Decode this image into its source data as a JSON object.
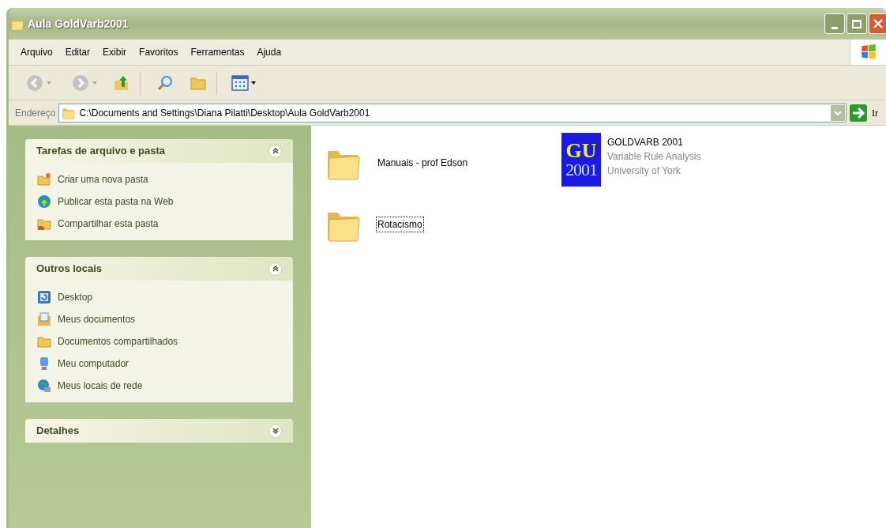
{
  "window": {
    "title": "Aula GoldVarb2001"
  },
  "menu": [
    "Arquivo",
    "Editar",
    "Exibir",
    "Favoritos",
    "Ferramentas",
    "Ajuda"
  ],
  "address": {
    "label": "Endereço",
    "value": "C:\\Documents and Settings\\Diana Pilatti\\Desktop\\Aula GoldVarb2001",
    "go": "Ir"
  },
  "sidebar": [
    {
      "title": "Tarefas de arquivo e pasta",
      "expanded": true,
      "items": [
        "Criar uma nova pasta",
        "Publicar esta pasta na Web",
        "Compartilhar esta pasta"
      ]
    },
    {
      "title": "Outros locais",
      "expanded": true,
      "items": [
        "Desktop",
        "Meus documentos",
        "Documentos compartilhados",
        "Meu computador",
        "Meus locais de rede"
      ]
    },
    {
      "title": "Detalhes",
      "expanded": false
    }
  ],
  "files": [
    {
      "kind": "folder",
      "name": "Manuais - prof Edson",
      "focused": false
    },
    {
      "kind": "app",
      "name": "GOLDVARB 2001",
      "logo": [
        "GU",
        "2001"
      ],
      "details": [
        "Variable Rule Analysis",
        "University of York"
      ],
      "focused": false
    },
    {
      "kind": "folder",
      "name": "Rotacismo",
      "focused": true
    }
  ]
}
